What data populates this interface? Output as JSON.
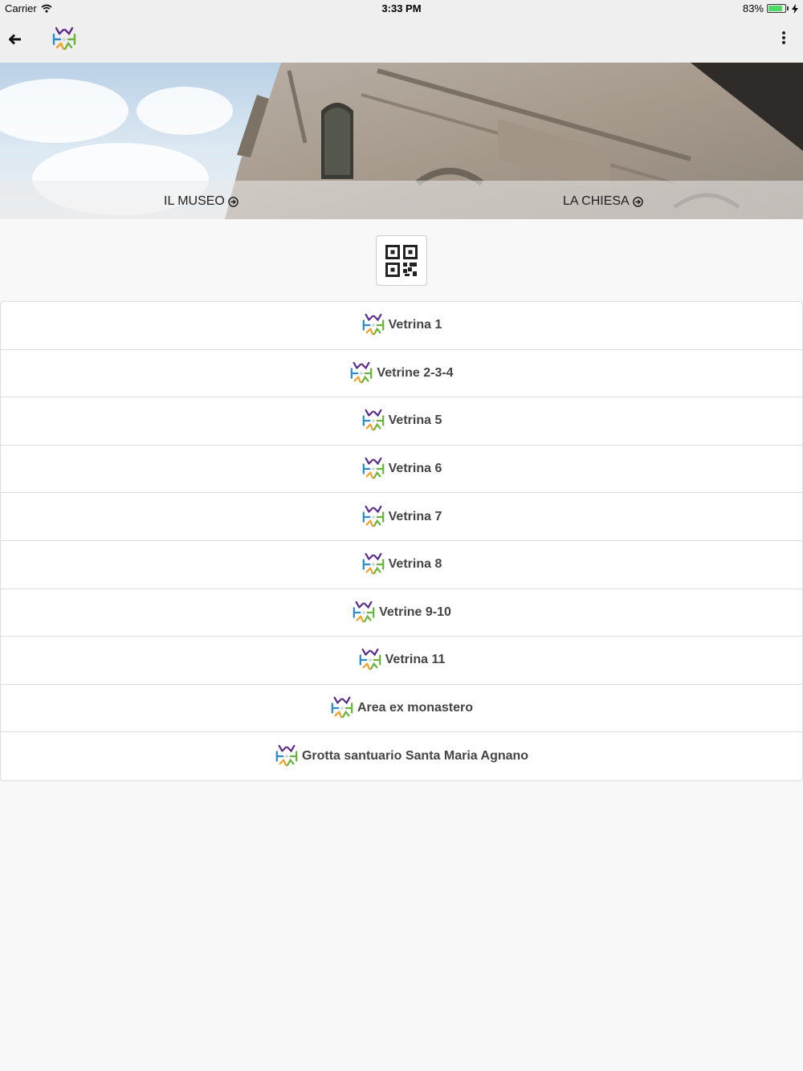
{
  "status": {
    "carrier": "Carrier",
    "time": "3:33 PM",
    "battery": "83%",
    "battery_level": 0.83
  },
  "nav": {
    "back_icon": "arrow-left-icon",
    "logo_icon": "app-logo-icon",
    "menu_icon": "more-vertical-icon"
  },
  "hero": {
    "link_left": "IL MUSEO",
    "link_right": "LA CHIESA"
  },
  "qr": {
    "icon": "qr-code-icon"
  },
  "list": [
    {
      "label": "Vetrina 1"
    },
    {
      "label": "Vetrine 2-3-4"
    },
    {
      "label": "Vetrina 5"
    },
    {
      "label": "Vetrina 6"
    },
    {
      "label": "Vetrina 7"
    },
    {
      "label": "Vetrina 8"
    },
    {
      "label": "Vetrine 9-10"
    },
    {
      "label": "Vetrina 11"
    },
    {
      "label": "Area ex monastero"
    },
    {
      "label": "Grotta santuario Santa Maria Agnano"
    }
  ],
  "colors": {
    "logo_purple": "#5b2d8a",
    "logo_blue": "#2e8bc9",
    "logo_green": "#6ab43e",
    "logo_orange": "#f0a22a",
    "battery_green": "#4cd964"
  }
}
